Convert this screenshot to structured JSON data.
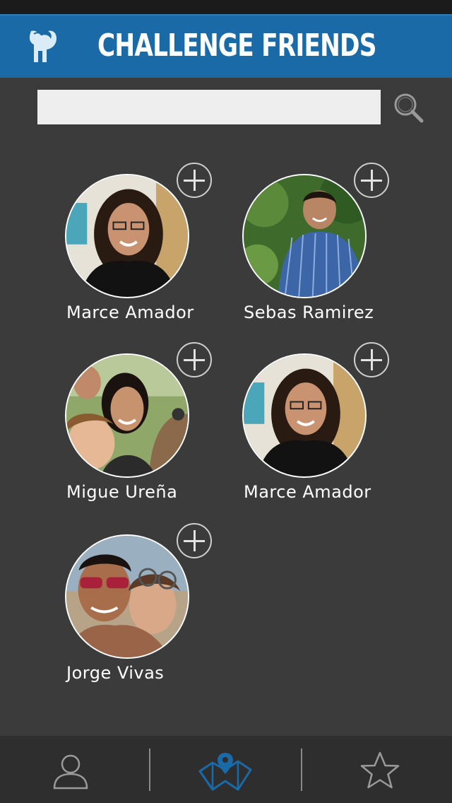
{
  "header": {
    "title": "CHALLENGE FRIENDS",
    "logo_icon": "goat-logo-icon",
    "bg_color": "#1a6aa8"
  },
  "search": {
    "value": "",
    "placeholder": "",
    "icon": "search-icon"
  },
  "friends": [
    {
      "name": "Marce Amador",
      "add_icon": "plus-icon"
    },
    {
      "name": "Sebas Ramirez",
      "add_icon": "plus-icon"
    },
    {
      "name": "Migue Ureña",
      "add_icon": "plus-icon"
    },
    {
      "name": "Marce Amador",
      "add_icon": "plus-icon"
    },
    {
      "name": "Jorge Vivas",
      "add_icon": "plus-icon"
    }
  ],
  "tab_bar": {
    "tabs": [
      {
        "icon": "profile-icon",
        "active": false
      },
      {
        "icon": "map-icon",
        "active": true
      },
      {
        "icon": "star-icon",
        "active": false
      }
    ],
    "active_color": "#1a6aa8",
    "inactive_color": "#9a9a9a"
  }
}
